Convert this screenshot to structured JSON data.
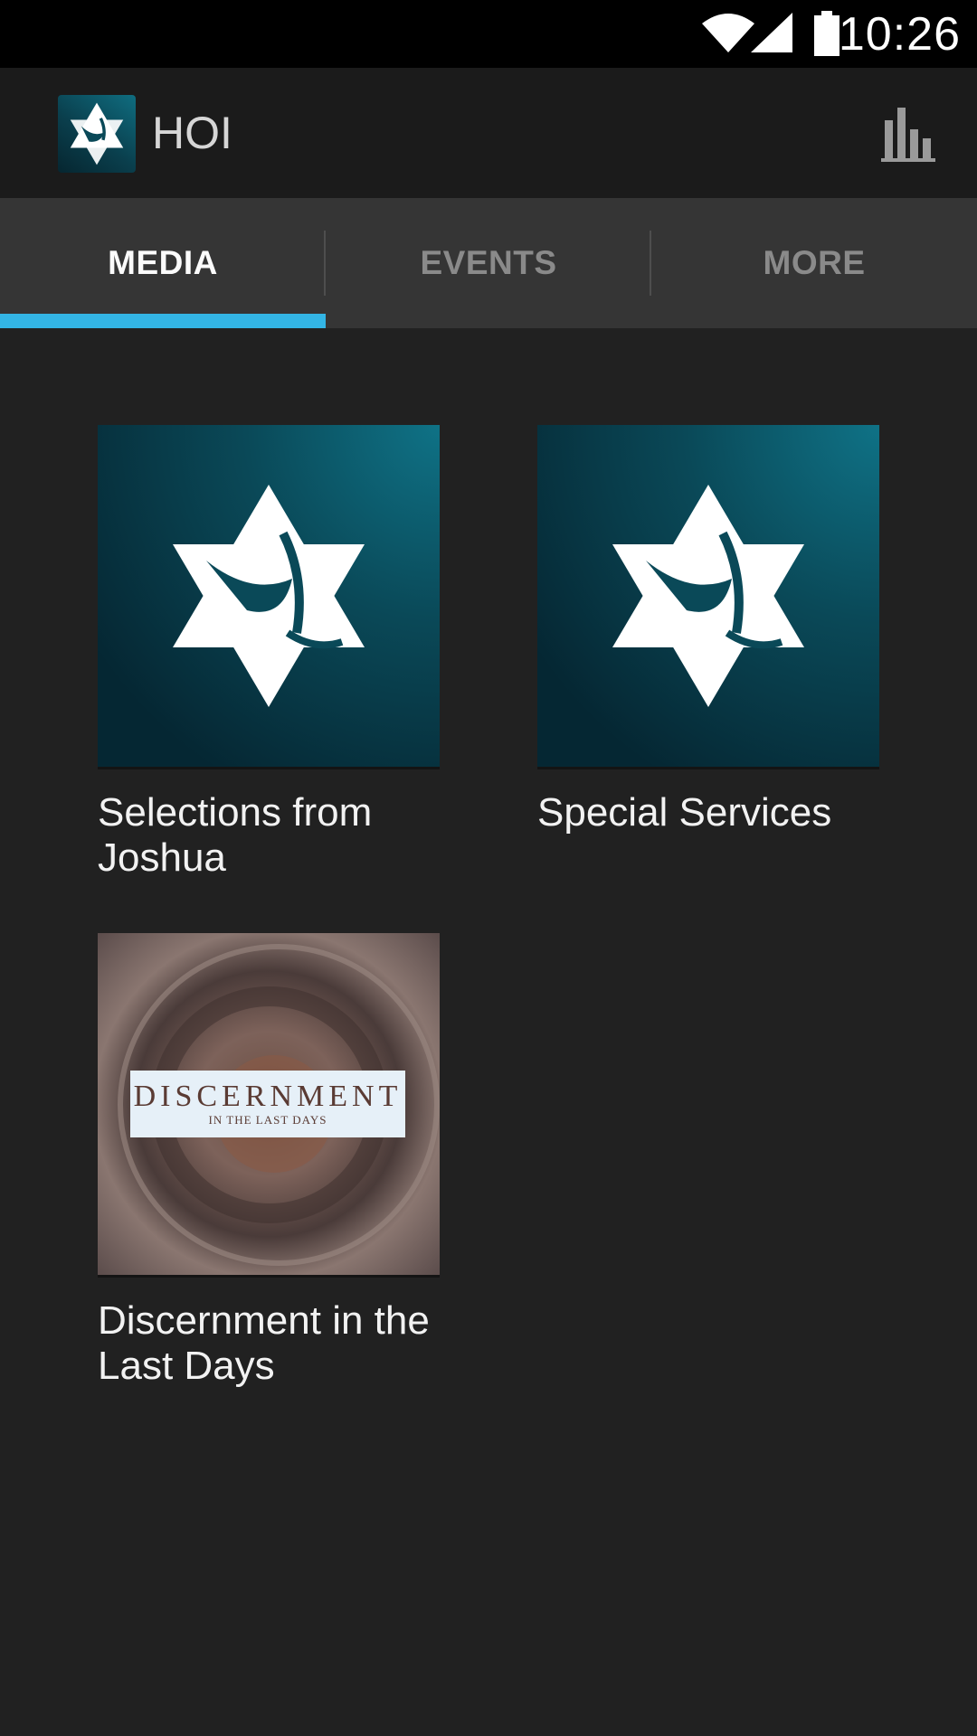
{
  "status_bar": {
    "time": "10:26",
    "icons": [
      "wifi-icon",
      "cell-signal-icon",
      "battery-icon"
    ]
  },
  "action_bar": {
    "title": "HOI",
    "app_icon": "star-dove-logo",
    "action_icon": "bar-chart-icon"
  },
  "tabs": [
    {
      "label": "MEDIA",
      "active": true
    },
    {
      "label": "EVENTS",
      "active": false
    },
    {
      "label": "MORE",
      "active": false
    }
  ],
  "accent_color": "#33b5e5",
  "media": [
    {
      "title": "Selections from Joshua",
      "art": "star-dove-logo"
    },
    {
      "title": "Special Services",
      "art": "star-dove-logo"
    },
    {
      "title": "Discernment in the Last Days",
      "art": "discernment-cover",
      "art_text": {
        "title": "DISCERNMENT",
        "subtitle": "IN THE LAST DAYS"
      }
    }
  ]
}
